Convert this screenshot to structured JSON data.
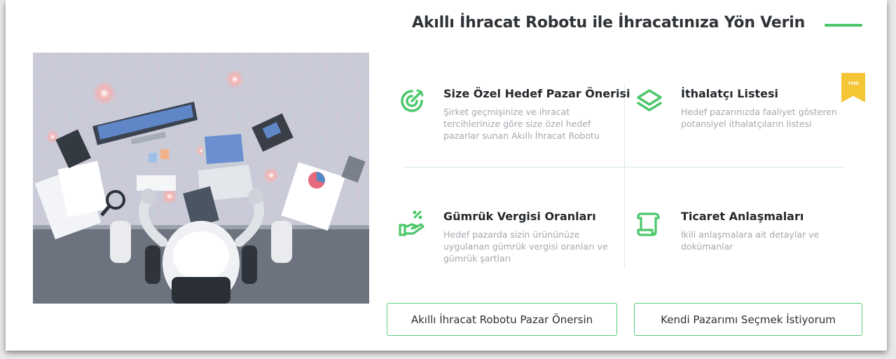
{
  "header": {
    "title": "Akıllı İhracat Robotu ile İhracatınıza Yön Verin",
    "accent_color": "#4cc76a"
  },
  "hero": {
    "icon": "robot-at-desk-illustration"
  },
  "features": [
    {
      "icon": "target-arrow-icon",
      "title": "Size Özel Hedef Pazar Önerisi",
      "description": "Şirket geçmişinize ve ihracat tercihlerinize göre size özel hedef pazarlar sunan Akıllı İhracat Robotu"
    },
    {
      "icon": "layers-icon",
      "title": "İthalatçı Listesi",
      "description": "Hedef pazarınızda faaliyet gösteren potansiyel ithalatçıların listesi",
      "badge": "YENİ"
    },
    {
      "icon": "hand-percent-icon",
      "title": "Gümrük Vergisi Oranları",
      "description": "Hedef pazarda sizin ürününüze uygulanan gümrük vergisi oranları ve gümrük şartları"
    },
    {
      "icon": "scroll-document-icon",
      "title": "Ticaret Anlaşmaları",
      "description": "İkili anlaşmalara ait detaylar ve dokümanlar"
    }
  ],
  "actions": {
    "robot_suggest": "Akıllı İhracat Robotu Pazar Önersin",
    "choose_own": "Kendi Pazarımı Seçmek İstiyorum"
  },
  "colors": {
    "accent": "#4cc76a",
    "badge": "#f4c636",
    "text_dark": "#25292d",
    "text_muted": "#a3a8ae"
  }
}
